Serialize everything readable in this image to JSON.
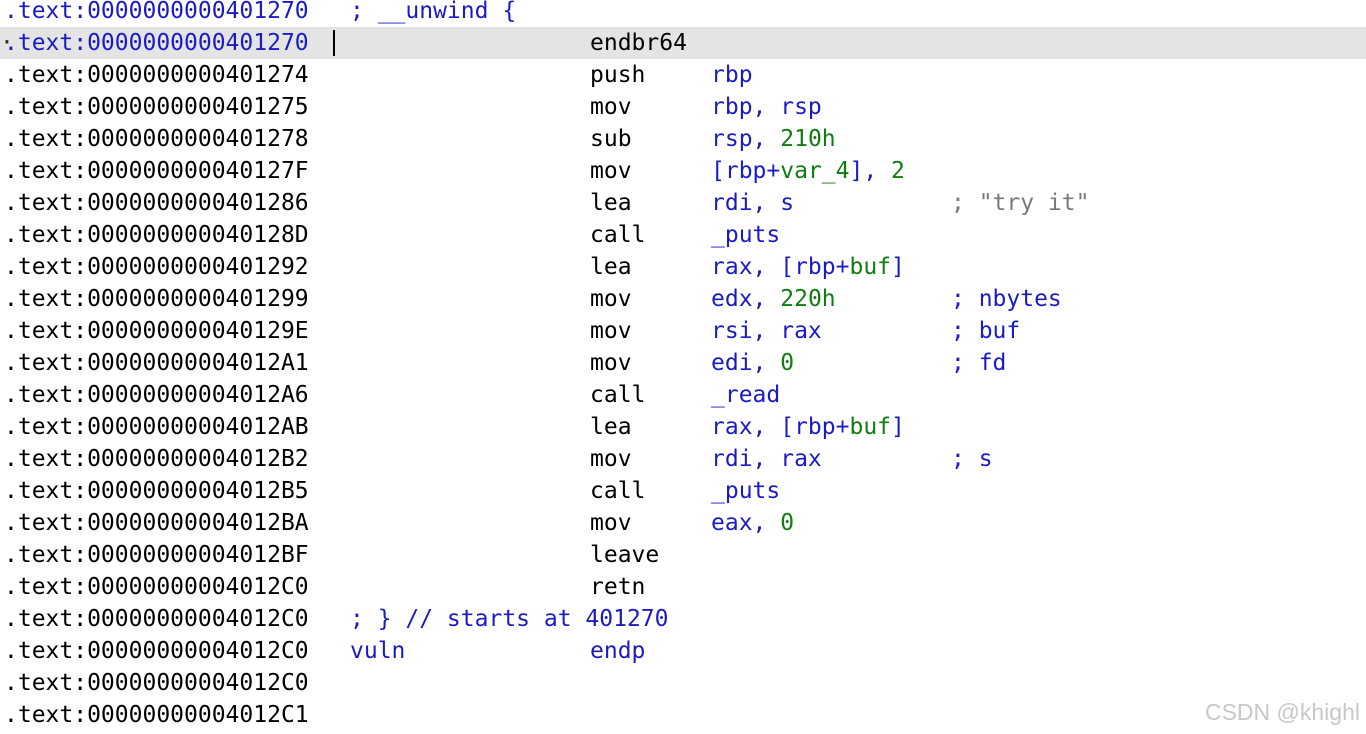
{
  "listing": {
    "header": {
      "address": ".text:0000000000401270",
      "comment": "; __unwind {"
    },
    "current_address": ".text:0000000000401270",
    "lines": [
      {
        "address": ".text:0000000000401274",
        "mnemonic": "push",
        "operand_parts": [
          {
            "text": "rbp",
            "color": "blue"
          }
        ],
        "comment": ""
      },
      {
        "address": ".text:0000000000401275",
        "mnemonic": "mov",
        "operand_parts": [
          {
            "text": "rbp, rsp",
            "color": "blue"
          }
        ],
        "comment": ""
      },
      {
        "address": ".text:0000000000401278",
        "mnemonic": "sub",
        "operand_parts": [
          {
            "text": "rsp, ",
            "color": "blue"
          },
          {
            "text": "210h",
            "color": "green"
          }
        ],
        "comment": ""
      },
      {
        "address": ".text:000000000040127F",
        "mnemonic": "mov",
        "operand_parts": [
          {
            "text": "[rbp+",
            "color": "blue"
          },
          {
            "text": "var_4",
            "color": "green"
          },
          {
            "text": "], ",
            "color": "blue"
          },
          {
            "text": "2",
            "color": "green"
          }
        ],
        "comment": ""
      },
      {
        "address": ".text:0000000000401286",
        "mnemonic": "lea",
        "operand_parts": [
          {
            "text": "rdi, s",
            "color": "blue"
          }
        ],
        "comment": "; \"try it\"",
        "comment_style": "string"
      },
      {
        "address": ".text:000000000040128D",
        "mnemonic": "call",
        "operand_parts": [
          {
            "text": "_puts",
            "color": "blue"
          }
        ],
        "comment": ""
      },
      {
        "address": ".text:0000000000401292",
        "mnemonic": "lea",
        "operand_parts": [
          {
            "text": "rax, [rbp+",
            "color": "blue"
          },
          {
            "text": "buf",
            "color": "green"
          },
          {
            "text": "]",
            "color": "blue"
          }
        ],
        "comment": ""
      },
      {
        "address": ".text:0000000000401299",
        "mnemonic": "mov",
        "operand_parts": [
          {
            "text": "edx, ",
            "color": "blue"
          },
          {
            "text": "220h",
            "color": "green"
          }
        ],
        "comment": "; nbytes"
      },
      {
        "address": ".text:000000000040129E",
        "mnemonic": "mov",
        "operand_parts": [
          {
            "text": "rsi, rax",
            "color": "blue"
          }
        ],
        "comment": "; buf"
      },
      {
        "address": ".text:00000000004012A1",
        "mnemonic": "mov",
        "operand_parts": [
          {
            "text": "edi, ",
            "color": "blue"
          },
          {
            "text": "0",
            "color": "green"
          }
        ],
        "comment": "; fd"
      },
      {
        "address": ".text:00000000004012A6",
        "mnemonic": "call",
        "operand_parts": [
          {
            "text": "_read",
            "color": "blue"
          }
        ],
        "comment": ""
      },
      {
        "address": ".text:00000000004012AB",
        "mnemonic": "lea",
        "operand_parts": [
          {
            "text": "rax, [rbp+",
            "color": "blue"
          },
          {
            "text": "buf",
            "color": "green"
          },
          {
            "text": "]",
            "color": "blue"
          }
        ],
        "comment": ""
      },
      {
        "address": ".text:00000000004012B2",
        "mnemonic": "mov",
        "operand_parts": [
          {
            "text": "rdi, rax",
            "color": "blue"
          }
        ],
        "comment": "; s"
      },
      {
        "address": ".text:00000000004012B5",
        "mnemonic": "call",
        "operand_parts": [
          {
            "text": "_puts",
            "color": "blue"
          }
        ],
        "comment": ""
      },
      {
        "address": ".text:00000000004012BA",
        "mnemonic": "mov",
        "operand_parts": [
          {
            "text": "eax, ",
            "color": "blue"
          },
          {
            "text": "0",
            "color": "green"
          }
        ],
        "comment": ""
      },
      {
        "address": ".text:00000000004012BF",
        "mnemonic": "leave",
        "operand_parts": [],
        "comment": ""
      },
      {
        "address": ".text:00000000004012C0",
        "mnemonic": "retn",
        "operand_parts": [],
        "comment": ""
      }
    ],
    "current_line": {
      "mnemonic": "endbr64"
    },
    "footer": {
      "end_comment": {
        "address": ".text:00000000004012C0",
        "text": "; } // starts at 401270"
      },
      "endp": {
        "address": ".text:00000000004012C0",
        "label": "vuln",
        "directive": "endp"
      },
      "blank_lines": [
        ".text:00000000004012C0",
        ".text:00000000004012C1"
      ]
    }
  },
  "watermark": "CSDN @khighl",
  "colors": {
    "keyword_blue": "#1b1bc4",
    "constant_green": "#0f7d0f",
    "string_gray": "#7a7a7a",
    "current_line_bg": "#e4e4e4"
  }
}
